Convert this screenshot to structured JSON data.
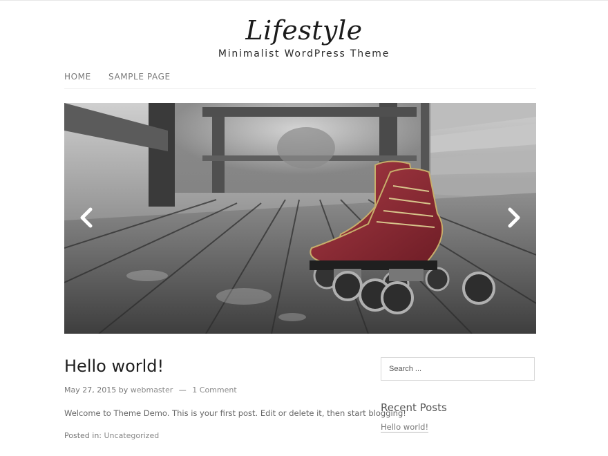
{
  "header": {
    "site_title": "Lifestyle",
    "tagline": "Minimalist WordPress Theme"
  },
  "nav": {
    "items": [
      {
        "label": "HOME"
      },
      {
        "label": "SAMPLE PAGE"
      }
    ]
  },
  "slider": {
    "image_description_icon": "roller-skates-photo",
    "prev_icon": "chevron-left-icon",
    "next_icon": "chevron-right-icon"
  },
  "post": {
    "title": "Hello world!",
    "date": "May 27, 2015",
    "by": "by",
    "author": "webmaster",
    "separator": "—",
    "comments": "1 Comment",
    "excerpt": "Welcome to Theme Demo. This is your first post. Edit or delete it, then start blogging!",
    "posted_in_label": "Posted in:",
    "category": "Uncategorized"
  },
  "sidebar": {
    "search_placeholder": "Search ...",
    "recent_posts_title": "Recent Posts",
    "recent_posts": [
      "Hello world!"
    ]
  },
  "colors": {
    "skate_red": "#8e2a33",
    "text_dark": "#1e1e1e",
    "text_muted": "#777777"
  }
}
